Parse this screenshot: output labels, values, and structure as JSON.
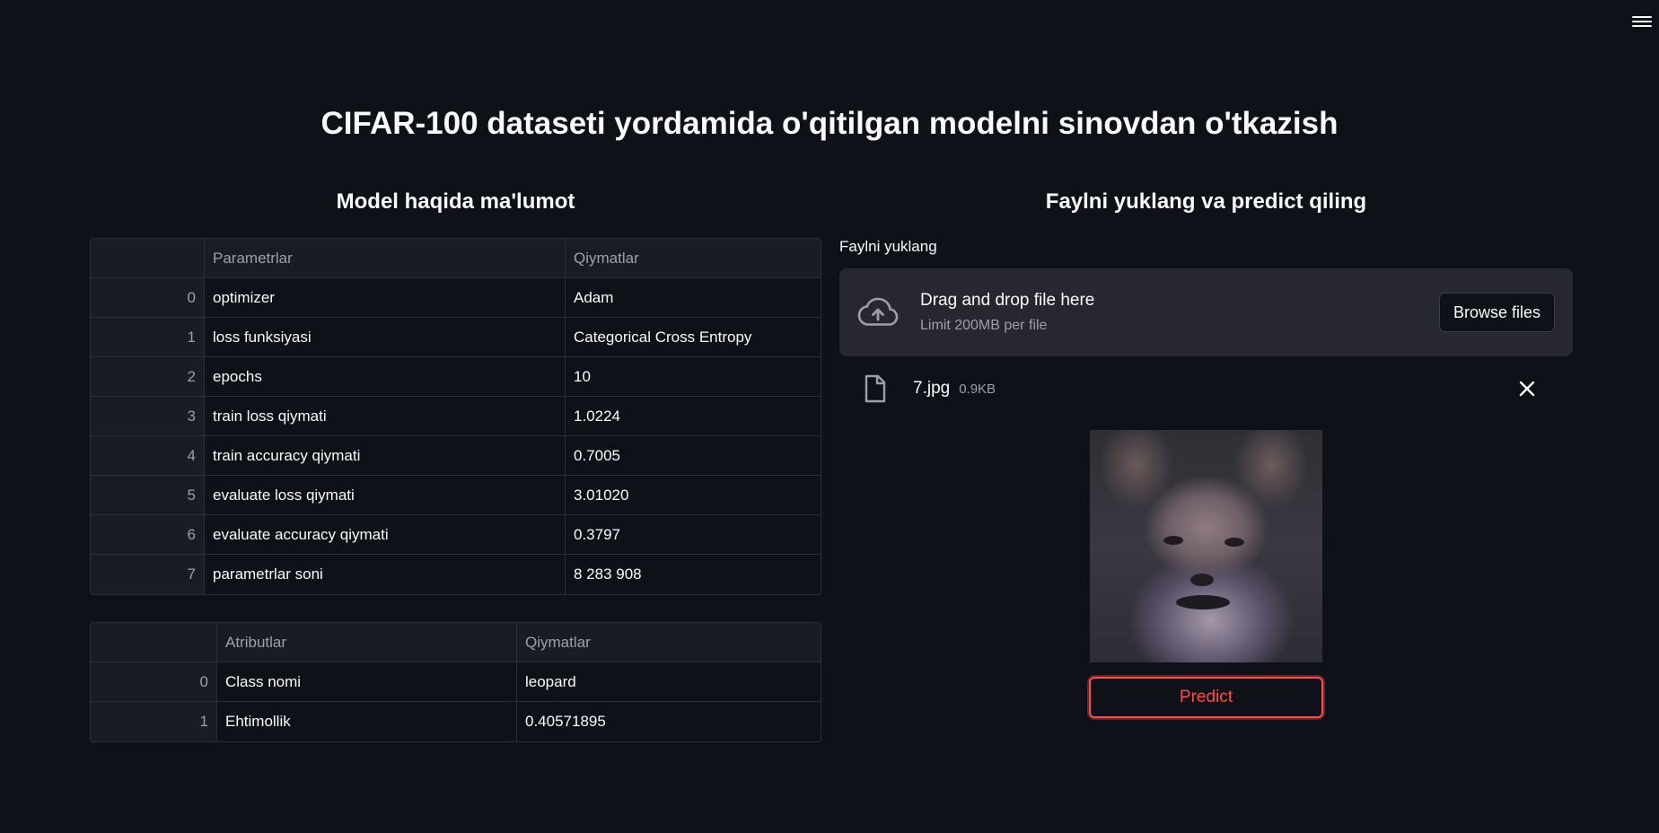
{
  "page": {
    "title": "CIFAR-100 dataseti yordamida o'qitilgan modelni sinovdan o'tkazish"
  },
  "left": {
    "heading": "Model haqida ma'lumot",
    "table1": {
      "columns": [
        "",
        "Parametrlar",
        "Qiymatlar"
      ],
      "rows": [
        {
          "index": "0",
          "param": "optimizer",
          "value": "Adam"
        },
        {
          "index": "1",
          "param": "loss funksiyasi",
          "value": "Categorical Cross Entropy"
        },
        {
          "index": "2",
          "param": "epochs",
          "value": "10"
        },
        {
          "index": "3",
          "param": "train loss qiymati",
          "value": "1.0224"
        },
        {
          "index": "4",
          "param": "train accuracy qiymati",
          "value": "0.7005"
        },
        {
          "index": "5",
          "param": "evaluate loss qiymati",
          "value": "3.01020"
        },
        {
          "index": "6",
          "param": "evaluate accuracy qiymati",
          "value": "0.3797"
        },
        {
          "index": "7",
          "param": "parametrlar soni",
          "value": "8 283 908"
        }
      ]
    },
    "table2": {
      "columns": [
        "",
        "Atributlar",
        "Qiymatlar"
      ],
      "rows": [
        {
          "index": "0",
          "attr": "Class nomi",
          "value": "leopard"
        },
        {
          "index": "1",
          "attr": "Ehtimollik",
          "value": "0.40571895"
        }
      ]
    }
  },
  "right": {
    "heading": "Faylni yuklang va predict qiling",
    "uploader": {
      "label": "Faylni yuklang",
      "drop_text": "Drag and drop file here",
      "limit_text": "Limit 200MB per file",
      "browse_label": "Browse files",
      "icon": "cloud-upload-icon"
    },
    "file": {
      "name": "7.jpg",
      "size": "0.9KB",
      "icon": "file-icon"
    },
    "predict_label": "Predict"
  },
  "colors": {
    "background": "#0e1117",
    "surface": "#262730",
    "accent": "#ff4b4b",
    "muted_text": "#9ea0a8"
  }
}
